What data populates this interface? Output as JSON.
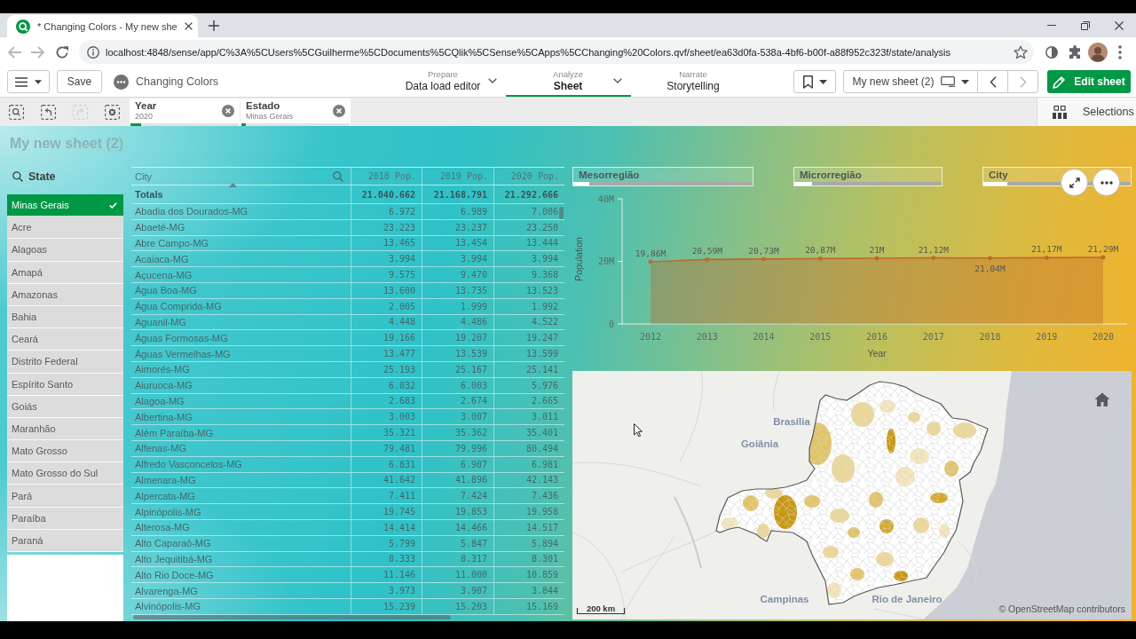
{
  "browser": {
    "tab_title": "* Changing Colors - My new she",
    "back": {
      "disabled": true
    },
    "forward": {
      "disabled": true
    },
    "url": "localhost:4848/sense/app/C%3A%5CUsers%5CGuilherme%5CDocuments%5CQlik%5CSense%5CApps%5CChanging%20Colors.qvf/sheet/ea63d0fa-538a-4bf6-b00f-a88f952c323f/state/analysis"
  },
  "toolbar": {
    "save": "Save",
    "app_name": "Changing Colors",
    "nav": [
      {
        "label": "Prepare",
        "value": "Data load editor",
        "dropdown": true,
        "selected": false
      },
      {
        "label": "Analyze",
        "value": "Sheet",
        "dropdown": true,
        "selected": true
      },
      {
        "label": "Narrate",
        "value": "Storytelling",
        "dropdown": false,
        "selected": false
      }
    ],
    "sheet_name": "My new sheet (2)",
    "previous": {
      "disabled": false
    },
    "next": {
      "disabled": true
    },
    "edit": "Edit sheet"
  },
  "selections": {
    "tools": [
      {
        "kind": "search",
        "disabled": false
      },
      {
        "kind": "back",
        "disabled": false
      },
      {
        "kind": "forward",
        "disabled": true
      },
      {
        "kind": "clear",
        "disabled": false
      }
    ],
    "chips": [
      {
        "field": "Year",
        "value": "2020",
        "level": 0.1
      },
      {
        "field": "Estado",
        "value": "Minas Gerais",
        "level": 0.04
      }
    ],
    "panel": "Selections"
  },
  "sheet": {
    "title": "My new sheet (2)"
  },
  "state_filter": {
    "title": "State",
    "items": [
      {
        "label": "Minas Gerais",
        "selected": true
      },
      {
        "label": "Acre",
        "selected": false
      },
      {
        "label": "Alagoas",
        "selected": false
      },
      {
        "label": "Amapá",
        "selected": false
      },
      {
        "label": "Amazonas",
        "selected": false
      },
      {
        "label": "Bahia",
        "selected": false
      },
      {
        "label": "Ceará",
        "selected": false
      },
      {
        "label": "Distrito Federal",
        "selected": false
      },
      {
        "label": "Espírito Santo",
        "selected": false
      },
      {
        "label": "Goiás",
        "selected": false
      },
      {
        "label": "Maranhão",
        "selected": false
      },
      {
        "label": "Mato Grosso",
        "selected": false
      },
      {
        "label": "Mato Grosso do Sul",
        "selected": false
      },
      {
        "label": "Pará",
        "selected": false
      },
      {
        "label": "Paraíba",
        "selected": false
      },
      {
        "label": "Paraná",
        "selected": false
      }
    ]
  },
  "table": {
    "columns": [
      {
        "label": "City",
        "kind": "dimension",
        "sorted": true
      },
      {
        "label": "2018 Pop.",
        "kind": "measure",
        "sorted": false
      },
      {
        "label": "2019 Pop.",
        "kind": "measure",
        "sorted": false
      },
      {
        "label": "2020 Pop.",
        "kind": "measure",
        "sorted": false
      }
    ],
    "totals": {
      "label": "Totals",
      "values": [
        "21.040.662",
        "21.168.791",
        "21.292.666"
      ]
    },
    "rows": [
      {
        "city": "Abadia dos Dourados-MG",
        "values": [
          "6.972",
          "6.989",
          "7.006"
        ]
      },
      {
        "city": "Abaeté-MG",
        "values": [
          "23.223",
          "23.237",
          "23.250"
        ]
      },
      {
        "city": "Abre Campo-MG",
        "values": [
          "13.465",
          "13.454",
          "13.444"
        ]
      },
      {
        "city": "Acaiaca-MG",
        "values": [
          "3.994",
          "3.994",
          "3.994"
        ]
      },
      {
        "city": "Açucena-MG",
        "values": [
          "9.575",
          "9.470",
          "9.368"
        ]
      },
      {
        "city": "Água Boa-MG",
        "values": [
          "13.600",
          "13.735",
          "13.523"
        ]
      },
      {
        "city": "Água Comprida-MG",
        "values": [
          "2.005",
          "1.999",
          "1.992"
        ]
      },
      {
        "city": "Aguanil-MG",
        "values": [
          "4.448",
          "4.486",
          "4.522"
        ]
      },
      {
        "city": "Águas Formosas-MG",
        "values": [
          "19.166",
          "19.207",
          "19.247"
        ]
      },
      {
        "city": "Águas Vermelhas-MG",
        "values": [
          "13.477",
          "13.539",
          "13.599"
        ]
      },
      {
        "city": "Aimorés-MG",
        "values": [
          "25.193",
          "25.167",
          "25.141"
        ]
      },
      {
        "city": "Aiuruoca-MG",
        "values": [
          "6.032",
          "6.003",
          "5.976"
        ]
      },
      {
        "city": "Alagoa-MG",
        "values": [
          "2.683",
          "2.674",
          "2.665"
        ]
      },
      {
        "city": "Albertina-MG",
        "values": [
          "3.003",
          "3.007",
          "3.011"
        ]
      },
      {
        "city": "Além Paraíba-MG",
        "values": [
          "35.321",
          "35.362",
          "35.401"
        ]
      },
      {
        "city": "Alfenas-MG",
        "values": [
          "79.481",
          "79.996",
          "80.494"
        ]
      },
      {
        "city": "Alfredo Vasconcelos-MG",
        "values": [
          "6.831",
          "6.907",
          "6.981"
        ]
      },
      {
        "city": "Almenara-MG",
        "values": [
          "41.642",
          "41.896",
          "42.143"
        ]
      },
      {
        "city": "Alpercata-MG",
        "values": [
          "7.411",
          "7.424",
          "7.436"
        ]
      },
      {
        "city": "Alpinópolis-MG",
        "values": [
          "19.745",
          "19.853",
          "19.958"
        ]
      },
      {
        "city": "Alterosa-MG",
        "values": [
          "14.414",
          "14.466",
          "14.517"
        ]
      },
      {
        "city": "Alto Caparaó-MG",
        "values": [
          "5.799",
          "5.847",
          "5.894"
        ]
      },
      {
        "city": "Alto Jequitibá-MG",
        "values": [
          "8.333",
          "8.317",
          "8.301"
        ]
      },
      {
        "city": "Alto Rio Doce-MG",
        "values": [
          "11.146",
          "11.000",
          "10.859"
        ]
      },
      {
        "city": "Alvarenga-MG",
        "values": [
          "3.973",
          "3.907",
          "3.844"
        ]
      },
      {
        "city": "Alvinópolis-MG",
        "values": [
          "15.239",
          "15.203",
          "15.169"
        ]
      }
    ]
  },
  "filters": [
    {
      "label": "Mesorregião",
      "level": 0.09
    },
    {
      "label": "Microrregião",
      "level": 0.12
    },
    {
      "label": "City",
      "level": 0.16
    }
  ],
  "chart": {
    "chart_data": {
      "type": "area",
      "xlabel": "Year",
      "ylabel": "Population",
      "categories": [
        "2012",
        "2013",
        "2014",
        "2015",
        "2016",
        "2017",
        "2018",
        "2019",
        "2020"
      ],
      "series": [
        {
          "color": "#c0692a",
          "values": [
            19860000,
            20590000,
            20730000,
            20870000,
            21000000,
            21120000,
            21040000,
            21170000,
            21290000
          ]
        }
      ],
      "ylim": [
        0,
        40000000
      ],
      "yticks": [
        {
          "value": 0,
          "label": "0"
        },
        {
          "value": 20000000,
          "label": "20M"
        },
        {
          "value": 40000000,
          "label": "40M"
        }
      ],
      "value_labels": [
        "19,86M",
        "20,59M",
        "20,73M",
        "20,87M",
        "21M",
        "21,12M",
        "21,04M",
        "21,17M",
        "21,29M"
      ]
    }
  },
  "map": {
    "labels": [
      "Brasília",
      "Goiânia",
      "Campinas",
      "Rio de Janeiro"
    ],
    "scale": "200 km",
    "attribution": "© OpenStreetMap contributors"
  }
}
